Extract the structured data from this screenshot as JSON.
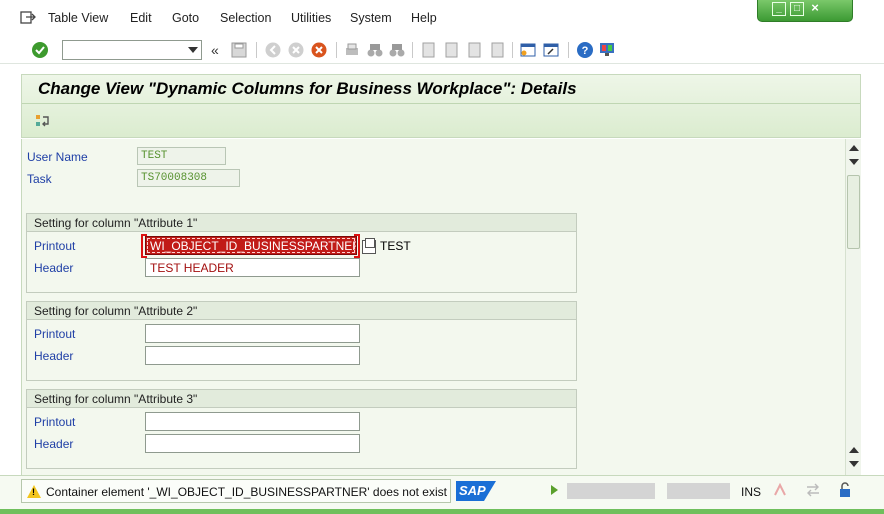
{
  "menu": {
    "items": [
      "Table View",
      "Edit",
      "Goto",
      "Selection",
      "Utilities",
      "System",
      "Help"
    ]
  },
  "toolbar": {
    "command_value": "",
    "back_chevrons": "«"
  },
  "header": {
    "title": "Change View \"Dynamic Columns for Business Workplace\": Details"
  },
  "fields": {
    "user_name_label": "User Name",
    "user_name_value": "TEST",
    "task_label": "Task",
    "task_value": "TS70008308"
  },
  "groups": [
    {
      "title": "Setting for column \"Attribute 1\"",
      "printout_label": "Printout",
      "printout_value": "WI_OBJECT_ID_BUSINESSPARTNER&",
      "printout_extra": "TEST",
      "header_label": "Header",
      "header_value": "TEST HEADER"
    },
    {
      "title": "Setting for column \"Attribute 2\"",
      "printout_label": "Printout",
      "printout_value": "",
      "header_label": "Header",
      "header_value": ""
    },
    {
      "title": "Setting for column \"Attribute 3\"",
      "printout_label": "Printout",
      "printout_value": "",
      "header_label": "Header",
      "header_value": ""
    }
  ],
  "status": {
    "message": "Container element '_WI_OBJECT_ID_BUSINESSPARTNER' does not exist",
    "logo": "SAP",
    "mode": "INS"
  },
  "colors": {
    "accent_green": "#3c9a33",
    "error_red": "#c11b17",
    "label_blue": "#1f3fa6"
  }
}
